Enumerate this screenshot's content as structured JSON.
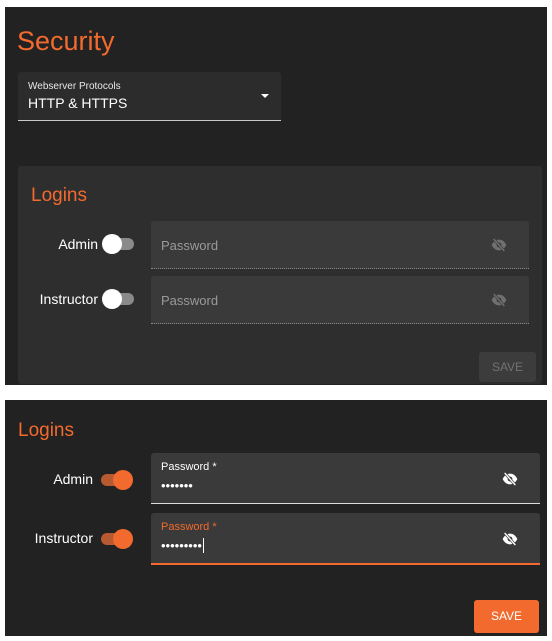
{
  "top": {
    "title": "Security",
    "protocol": {
      "label": "Webserver Protocols",
      "value": "HTTP & HTTPS"
    },
    "logins": {
      "title": "Logins",
      "rows": [
        {
          "label": "Admin",
          "enabled": false,
          "placeholder": "Password",
          "value": ""
        },
        {
          "label": "Instructor",
          "enabled": false,
          "placeholder": "Password",
          "value": ""
        }
      ],
      "save_label": "SAVE"
    }
  },
  "bottom": {
    "logins": {
      "title": "Logins",
      "rows": [
        {
          "label": "Admin",
          "enabled": true,
          "field_label": "Password *",
          "value": "•••••••"
        },
        {
          "label": "Instructor",
          "enabled": true,
          "field_label": "Password *",
          "value": "•••••••••"
        }
      ],
      "save_label": "SAVE"
    }
  },
  "colors": {
    "accent": "#f26a2e",
    "background": "#222222",
    "card": "#2e2e2e"
  }
}
